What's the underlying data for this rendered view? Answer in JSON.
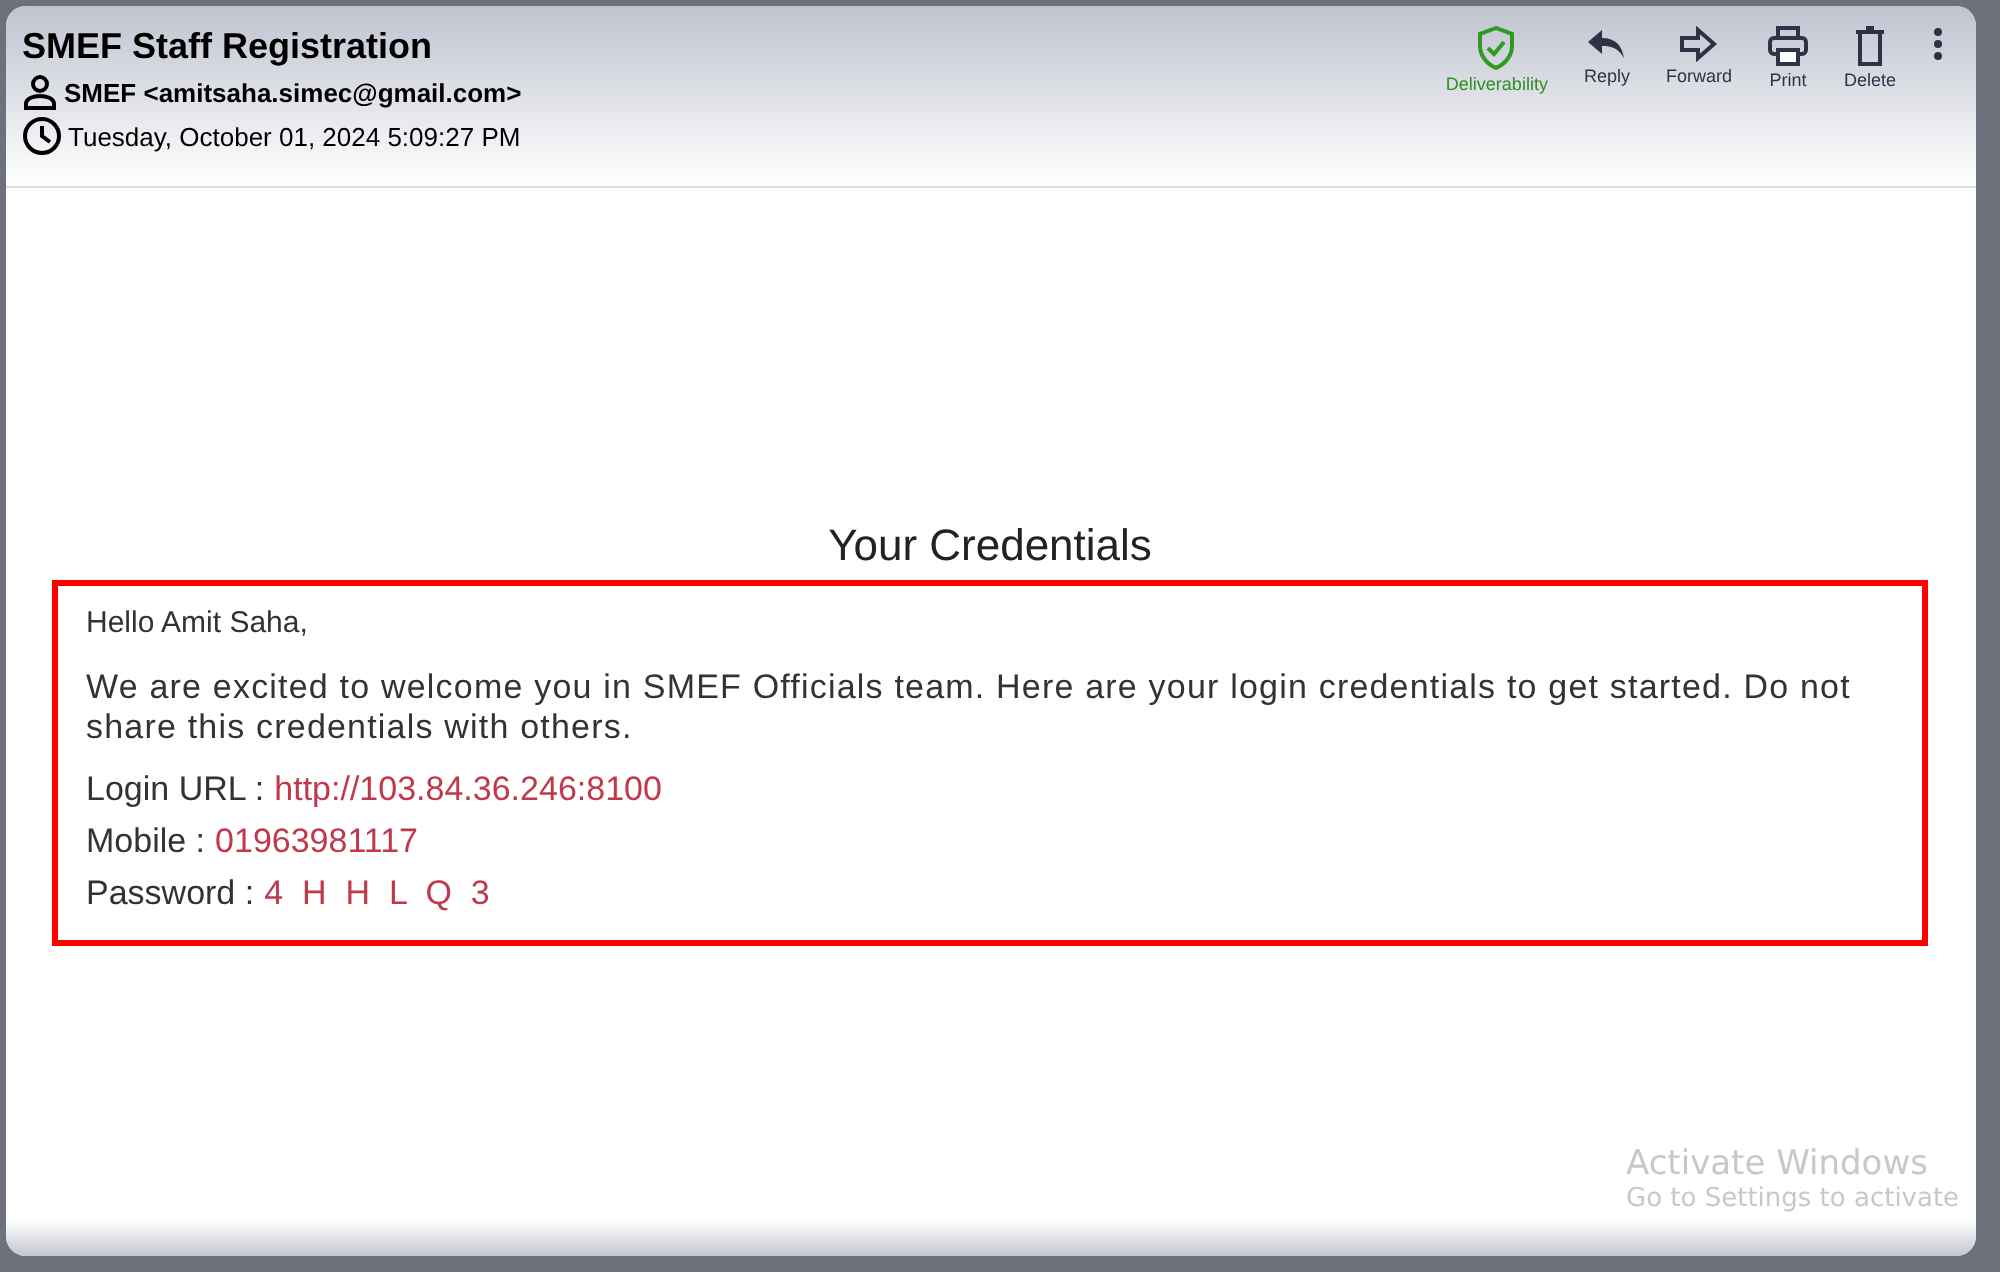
{
  "header": {
    "subject": "SMEF Staff Registration",
    "sender": "SMEF <amitsaha.simec@gmail.com>",
    "date": "Tuesday, October 01, 2024 5:09:27 PM"
  },
  "toolbar": [
    {
      "kind": "shield",
      "label": "Deliverability"
    },
    {
      "kind": "reply",
      "label": "Reply"
    },
    {
      "kind": "forward",
      "label": "Forward"
    },
    {
      "kind": "print",
      "label": "Print"
    },
    {
      "kind": "delete",
      "label": "Delete"
    },
    {
      "kind": "more"
    }
  ],
  "message": {
    "title": "Your Credentials",
    "greeting": "Hello Amit Saha,",
    "intro": "We are excited to welcome you in SMEF Officials team. Here are your login credentials to get started. Do not share this credentials with others.",
    "fields": [
      {
        "label": "Login URL :",
        "value": "http://103.84.36.246:8100"
      },
      {
        "label": "Mobile :",
        "value": "01963981117"
      },
      {
        "label": "Password :",
        "value": "4  H  H  L  Q  3"
      }
    ]
  },
  "os_notice": {
    "title": "Activate Windows",
    "text": "Go to Settings to activate"
  }
}
